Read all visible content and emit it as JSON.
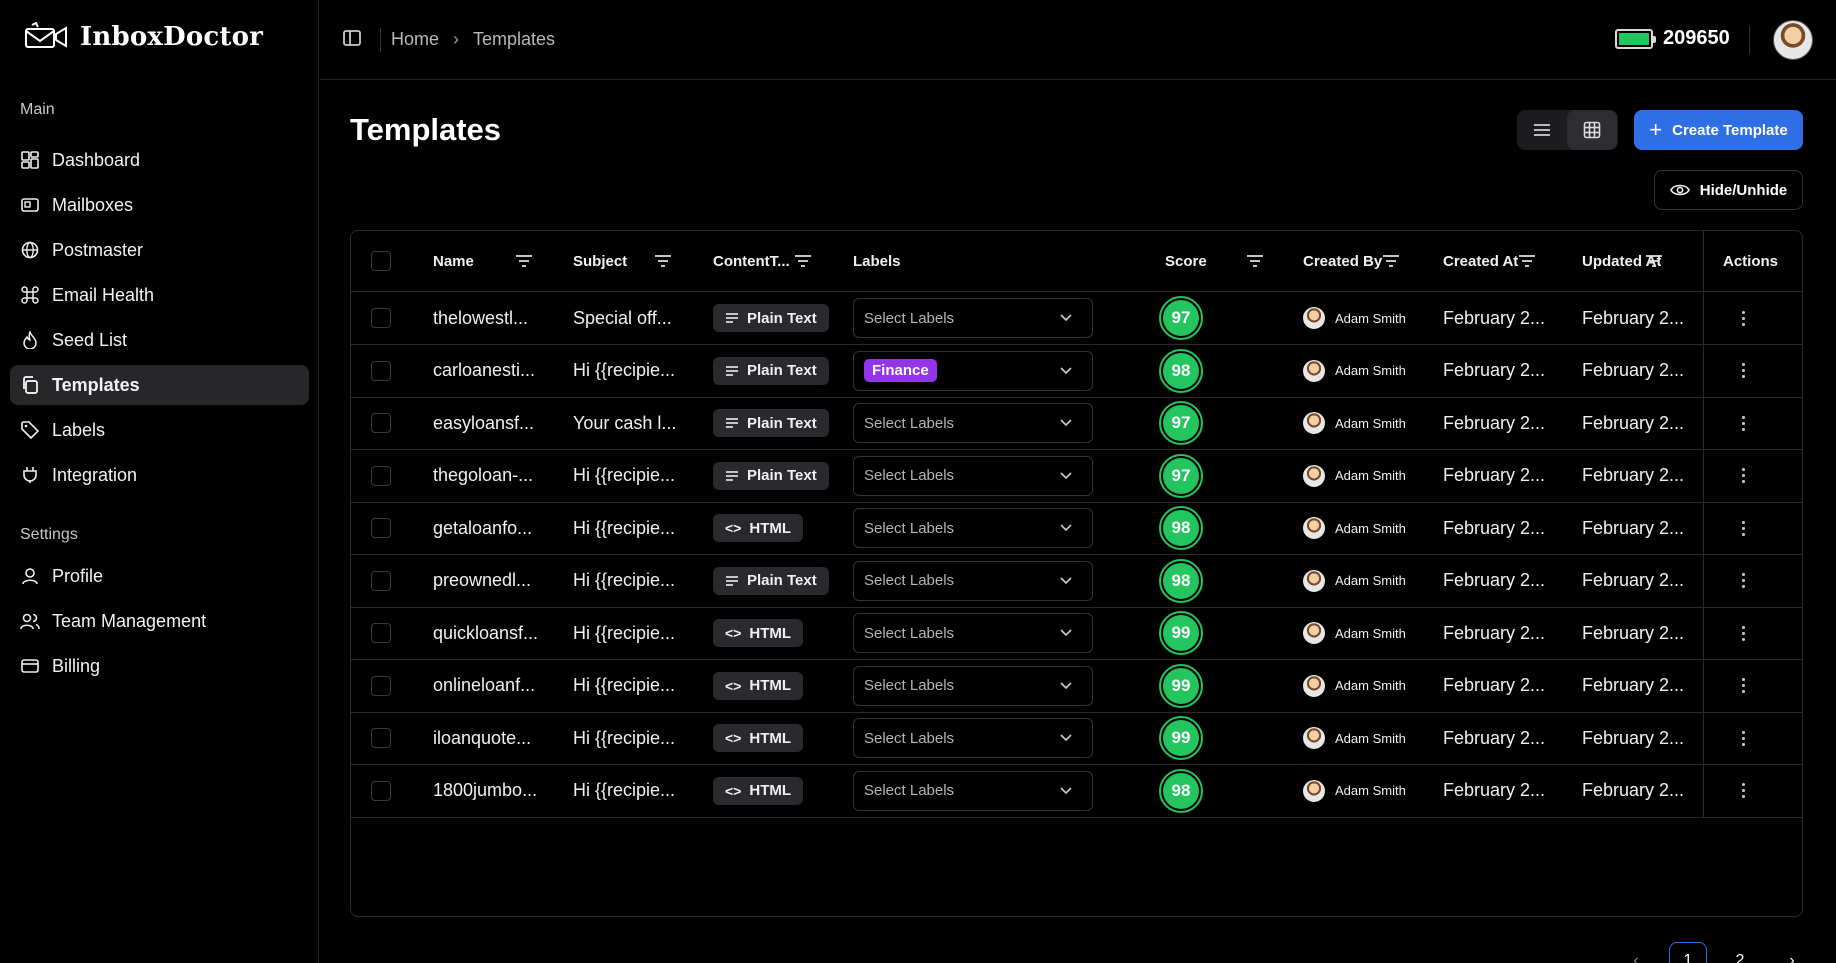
{
  "app": {
    "name": "InboxDoctor"
  },
  "sidebar": {
    "main_title": "Main",
    "main_items": [
      {
        "label": "Dashboard",
        "icon": "dashboard-icon"
      },
      {
        "label": "Mailboxes",
        "icon": "mailbox-icon"
      },
      {
        "label": "Postmaster",
        "icon": "globe-icon"
      },
      {
        "label": "Email Health",
        "icon": "command-icon"
      },
      {
        "label": "Seed List",
        "icon": "flame-icon"
      },
      {
        "label": "Templates",
        "icon": "copy-icon",
        "active": true
      },
      {
        "label": "Labels",
        "icon": "tag-icon"
      },
      {
        "label": "Integration",
        "icon": "plug-icon"
      }
    ],
    "settings_title": "Settings",
    "settings_items": [
      {
        "label": "Profile",
        "icon": "user-icon"
      },
      {
        "label": "Team Management",
        "icon": "users-icon"
      },
      {
        "label": "Billing",
        "icon": "card-icon"
      }
    ]
  },
  "header": {
    "breadcrumbs": [
      "Home",
      "Templates"
    ],
    "credits": "209650",
    "credits_level": 1.0
  },
  "page": {
    "title": "Templates",
    "create_label": "Create Template",
    "hide_label": "Hide/Unhide"
  },
  "table": {
    "columns": [
      "Name",
      "Subject",
      "ContentT...",
      "Labels",
      "Score",
      "Created By",
      "Created At",
      "Updated At",
      "Actions"
    ],
    "rows": [
      {
        "name": "thelowestl...",
        "subject": "Special off...",
        "content": "Plain Text",
        "label": "Select Labels",
        "label_selected": false,
        "score": "97",
        "created_by": "Adam Smith",
        "created_at": "February 2...",
        "updated_at": "February 2..."
      },
      {
        "name": "carloanesti...",
        "subject": "Hi {{recipie...",
        "content": "Plain Text",
        "label": "Finance",
        "label_selected": true,
        "score": "98",
        "created_by": "Adam Smith",
        "created_at": "February 2...",
        "updated_at": "February 2..."
      },
      {
        "name": "easyloansf...",
        "subject": "Your cash l...",
        "content": "Plain Text",
        "label": "Select Labels",
        "label_selected": false,
        "score": "97",
        "created_by": "Adam Smith",
        "created_at": "February 2...",
        "updated_at": "February 2..."
      },
      {
        "name": "thegoloan-...",
        "subject": "Hi {{recipie...",
        "content": "Plain Text",
        "label": "Select Labels",
        "label_selected": false,
        "score": "97",
        "created_by": "Adam Smith",
        "created_at": "February 2...",
        "updated_at": "February 2..."
      },
      {
        "name": "getaloanfo...",
        "subject": "Hi {{recipie...",
        "content": "HTML",
        "label": "Select Labels",
        "label_selected": false,
        "score": "98",
        "created_by": "Adam Smith",
        "created_at": "February 2...",
        "updated_at": "February 2..."
      },
      {
        "name": "preownedl...",
        "subject": "Hi {{recipie...",
        "content": "Plain Text",
        "label": "Select Labels",
        "label_selected": false,
        "score": "98",
        "created_by": "Adam Smith",
        "created_at": "February 2...",
        "updated_at": "February 2..."
      },
      {
        "name": "quickloansf...",
        "subject": "Hi {{recipie...",
        "content": "HTML",
        "label": "Select Labels",
        "label_selected": false,
        "score": "99",
        "created_by": "Adam Smith",
        "created_at": "February 2...",
        "updated_at": "February 2..."
      },
      {
        "name": "onlineloanf...",
        "subject": "Hi {{recipie...",
        "content": "HTML",
        "label": "Select Labels",
        "label_selected": false,
        "score": "99",
        "created_by": "Adam Smith",
        "created_at": "February 2...",
        "updated_at": "February 2..."
      },
      {
        "name": "iloanquote...",
        "subject": "Hi {{recipie...",
        "content": "HTML",
        "label": "Select Labels",
        "label_selected": false,
        "score": "99",
        "created_by": "Adam Smith",
        "created_at": "February 2...",
        "updated_at": "February 2..."
      },
      {
        "name": "1800jumbo...",
        "subject": "Hi {{recipie...",
        "content": "HTML",
        "label": "Select Labels",
        "label_selected": false,
        "score": "98",
        "created_by": "Adam Smith",
        "created_at": "February 2...",
        "updated_at": "February 2..."
      }
    ]
  },
  "pagination": {
    "pages": [
      "1",
      "2"
    ],
    "current": "1"
  },
  "colors": {
    "accent": "#2f6fe6",
    "score": "#22c55e",
    "label_finance": "#9333ea",
    "bg": "#000000"
  }
}
